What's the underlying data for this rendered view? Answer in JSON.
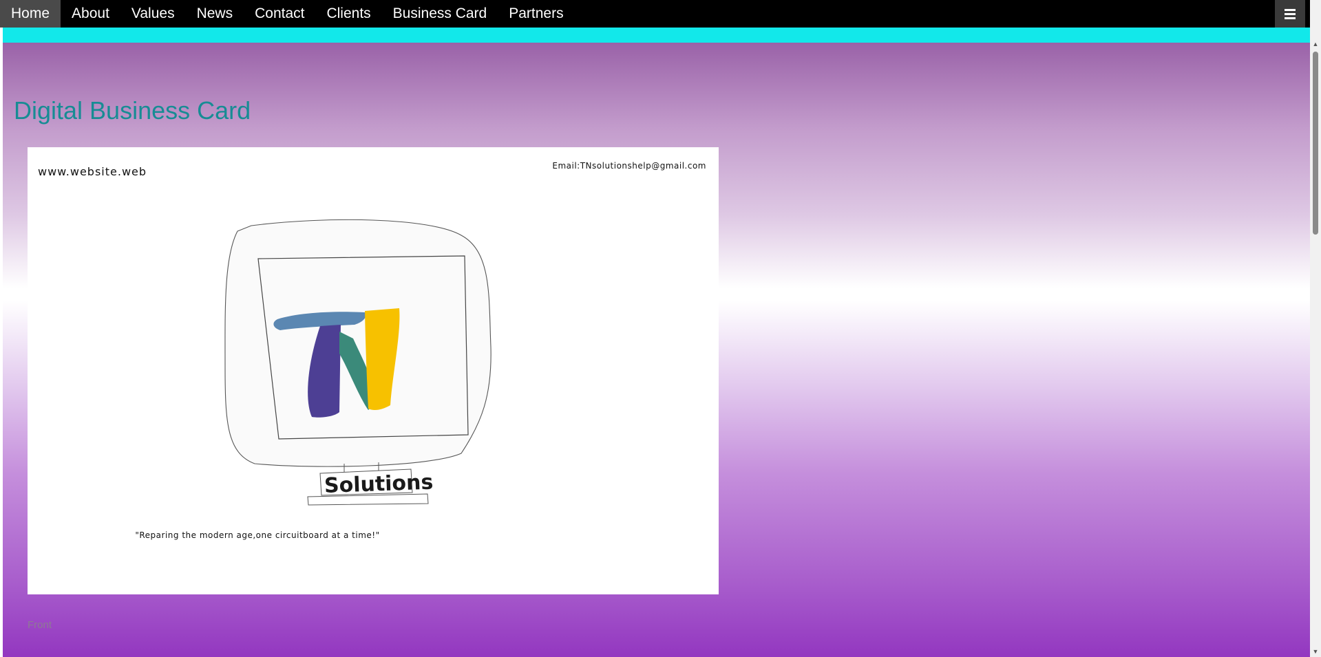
{
  "nav": {
    "items": [
      {
        "label": "Home",
        "active": true
      },
      {
        "label": "About"
      },
      {
        "label": "Values"
      },
      {
        "label": "News"
      },
      {
        "label": "Contact"
      },
      {
        "label": "Clients"
      },
      {
        "label": "Business Card"
      },
      {
        "label": "Partners"
      }
    ],
    "menu_icon": "hamburger-menu-icon"
  },
  "colors": {
    "nav_bg": "#000000",
    "accent_strip": "#12e8ea",
    "title": "#178c94",
    "gradient_top": "#9a62a8",
    "gradient_bottom": "#9337c0"
  },
  "page": {
    "title": "Digital Business Card"
  },
  "card": {
    "website": "www.website.web",
    "email": "Email:TNsolutionshelp@gmail.com",
    "logo_text": "Solutions",
    "slogan": "\"Reparing the modern age,one circuitboard at a time!\"",
    "label": "Front"
  }
}
